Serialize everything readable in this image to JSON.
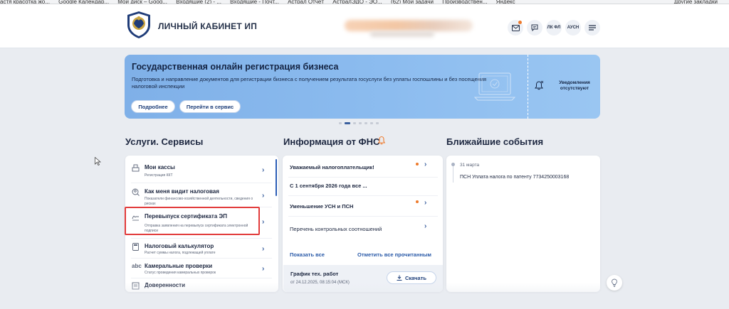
{
  "bookmarks": {
    "items": [
      "астя красотка жо...",
      "Google Календар...",
      "Мой диск – Goog...",
      "Входящие (2) - ...",
      "Входящие - Почт...",
      "Астрал Отчёт",
      "АстралЭДО - ЭО...",
      "(62) Мои задачи",
      "Производствен...",
      "Яндекс"
    ],
    "other": "Другие закладки"
  },
  "header": {
    "title": "ЛИЧНЫЙ КАБИНЕТ ИП",
    "btn_lkfl": "ЛК ФЛ",
    "btn_ausn": "АУСН"
  },
  "banner": {
    "title": "Государственная онлайн регистрация бизнеса",
    "description": "Подготовка и направление документов для регистрации бизнеса с получением результата госуслуги без уплаты госпошлины и без посещения налоговой инспекции",
    "btn_more": "Подробнее",
    "btn_go": "Перейти в сервис",
    "notifications": "Уведомления отсутствуют",
    "slides": 7,
    "active_slide": 1
  },
  "services": {
    "title": "Услуги. Сервисы",
    "items": [
      {
        "title": "Мои кассы",
        "desc": "Регистрация ККТ",
        "icon": "register-icon"
      },
      {
        "title": "Как меня видит налоговая",
        "desc": "Показатели финансово-хозяйственной деятельности, сведения о рисках",
        "icon": "eye-search-icon"
      },
      {
        "title": "Перевыпуск сертификата ЭП",
        "desc": "Отправка заявления на перевыпуск сертификата электронной подписи",
        "icon": "signature-icon"
      },
      {
        "title": "Налоговый калькулятор",
        "desc": "Расчет суммы налога, подлежащей уплате",
        "icon": "calculator-icon"
      },
      {
        "title": "Камеральные проверки",
        "desc": "Статус проведения камеральных проверок",
        "icon": "abc-check-icon"
      },
      {
        "title": "Доверенности",
        "desc": "",
        "icon": "document-icon"
      }
    ]
  },
  "fns": {
    "title": "Информация от ФНС",
    "items": [
      {
        "text": "Уважаемый налогоплательщик!",
        "unread": true,
        "bold": true
      },
      {
        "text": "С 1 сентября 2026 года все ...",
        "unread": false,
        "bold": true
      },
      {
        "text": "Уменьшение УСН и ПСН",
        "unread": true,
        "bold": true
      },
      {
        "text": "Перечень контрольных соотношений",
        "unread": false,
        "bold": false
      }
    ],
    "show_all": "Показать все",
    "mark_all_read": "Отметить все прочитанным",
    "schedule_title": "График тех. работ",
    "schedule_date": "от 24.12.2025, 08:15:04 (МСК)",
    "download": "Скачать"
  },
  "events": {
    "title": "Ближайшие события",
    "items": [
      {
        "date": "31 марта",
        "text": "ПСН Уплата налога по патенту 7734250003168"
      }
    ]
  },
  "colors": {
    "accent": "#2a5aa8",
    "banner": "#8cbcef",
    "highlight": "#e23b3b",
    "unread": "#ee7a2c"
  }
}
